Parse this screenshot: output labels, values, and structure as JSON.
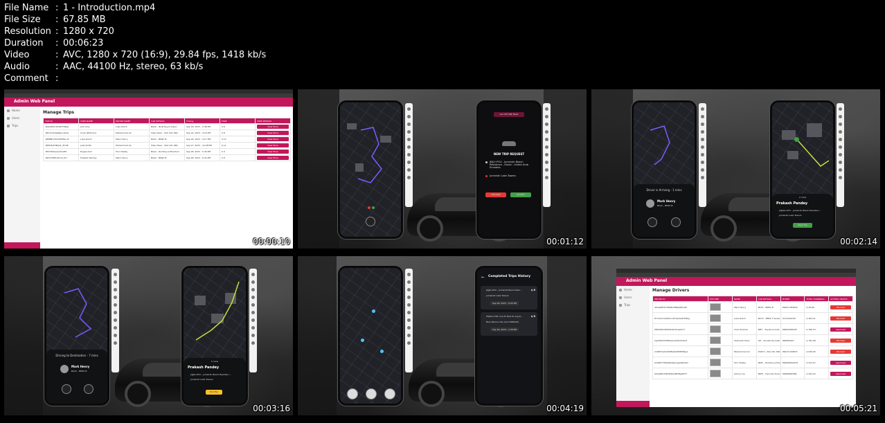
{
  "metadata": [
    {
      "key": "File Name",
      "value": "1 - Introduction.mp4"
    },
    {
      "key": "File Size",
      "value": "67.85 MB"
    },
    {
      "key": "Resolution",
      "value": "1280 x 720"
    },
    {
      "key": "Duration",
      "value": "00:06:23"
    },
    {
      "key": "Video",
      "value": "AVC, 1280 x 720 (16:9), 29.84 fps, 1418 kb/s"
    },
    {
      "key": "Audio",
      "value": "AAC, 44100 Hz, stereo, 63 kb/s"
    },
    {
      "key": "Comment",
      "value": ""
    }
  ],
  "separator": ":",
  "thumbnails": [
    {
      "timestamp": "00:00:10"
    },
    {
      "timestamp": "00:01:12"
    },
    {
      "timestamp": "00:02:14"
    },
    {
      "timestamp": "00:03:16"
    },
    {
      "timestamp": "00:04:19"
    },
    {
      "timestamp": "00:05:21"
    }
  ],
  "admin": {
    "panel_title": "Admin Web Panel",
    "sidebar": [
      "Home",
      "Users",
      "Trips"
    ],
    "trips": {
      "title": "Manage Trips",
      "headers": [
        "TRIP ID",
        "USER NAME",
        "DRIVER NAME",
        "CAR DETAILS",
        "Timing",
        "FARE",
        "VIEW DETAILS"
      ],
      "view_label": "View More",
      "rows": [
        [
          "-NeG9Mhr3K4QfTTNjlw",
          "John Doe",
          "Luke Dutch",
          "Black - Rolls Royce Dawn",
          "Sep 18, 2023 - 2:48 PM",
          "$ 6",
          ""
        ],
        [
          "-NfC1m0QpjNkpvuKhw",
          "Andy Whitmore",
          "Muhammad Ali",
          "Silky Silver - Kite VXL 660",
          "Sep 24, 2023 - 3:16 PM",
          "$ 8",
          ""
        ],
        [
          "-NfNBEr2hkxI9FPNxu B",
          "Luka Dutch",
          "Mark Henry",
          "Black - BMW i8",
          "Sep 26, 2023 - 4:17 PM",
          "$ 12",
          ""
        ],
        [
          "-NfNV6j7HBqx9_rHc5E",
          "Julia Smith",
          "Muhammad Ali",
          "Silky Silver - Kite VXL 660",
          "Sep 27, 2023 - 12:48 PM",
          "$ 11",
          ""
        ],
        [
          "-NfVY9GkiprJoXIocE6",
          "Rogers Kim",
          "Tom Shelby",
          "Black - Roll Royce Phantom",
          "Sep 28, 2023 - 5:40 PM",
          "$ 9",
          ""
        ],
        [
          "-NfQoTWEkdkmX_6rY",
          "Prakash Pandey",
          "Mark Henry",
          "Black - BMW i8",
          "Sep 28, 2023 - 6:34 PM",
          "$ 8",
          ""
        ]
      ]
    },
    "drivers": {
      "title": "Manage Drivers",
      "headers": [
        "DRIVER ID",
        "PICTURE",
        "NAME",
        "CAR DETAILS",
        "PHONE",
        "TOTAL EARNINGS",
        "ACTION / BLOCK"
      ],
      "rows": [
        [
          "4KvaRRhTc7ZRMmMBpDRSx4R",
          "",
          "Mark Henry",
          "BT23 - BMW i8",
          "09005 983650",
          "$ 28.96",
          "Blocked"
        ],
        [
          "EYmhYmxtAKPrnnt07Jx4Q9T5MkjJ",
          "",
          "Luke Dutch",
          "BX72 - BMW 3 Series",
          "0712349790",
          "$ 360.21",
          "Blocked"
        ],
        [
          "PDtIIQ0tdTeFAKCGDYCaj0UY3",
          "",
          "Vinol Sharma",
          "BM7 - Toyota Corolla",
          "09809568978",
          "$ 786.53",
          "Approved"
        ],
        [
          "hgVWPL39TB09qcobOt4dm022",
          "",
          "Shamoah Khan",
          "GH - Sonata Hyundai",
          "090669421",
          "$ 792.08",
          "Blocked"
        ],
        [
          "m4EWme9vWlM5aZsH08H5RJuL",
          "",
          "Muhammad Ali",
          "KS673 - Kite VXL 660",
          "09015 009874",
          "$ 926.95",
          "Blocked"
        ],
        [
          "OoNRF7TMte0PGKeniqpbQRG2Q",
          "",
          "Tom Shelby",
          "MMC - Roll Royce Phantom",
          "090696560233",
          "$ 223.67",
          "Approved"
        ],
        [
          "QXe4RExSfb59tSDeMHMgQPVT",
          "",
          "Johnny Ive",
          "BKTS - Hyundai Tucson",
          "09086680484",
          "$ 444.25",
          "Approved"
        ]
      ]
    }
  },
  "phones": {
    "trip_request": {
      "title": "NEW TRIP REQUEST",
      "pickup": "JKJJ4+PCX - Jumeirah Beach Residence - Dubai - United Arab Emirates",
      "dropoff": "Jumeirah Lake Towers",
      "decline": "DECLINE",
      "accept": "ACCEPT",
      "status": "GO OFFLINE NOW"
    },
    "arriving": {
      "status": "Driver is Arriving - 1 mins",
      "driver_name": "Mark Henry",
      "car": "Black - BMW i8"
    },
    "user_sheet": {
      "distance": "2 mins",
      "name": "Prakash Pandey",
      "pickup": "J4J2J4+PCX - Jumeirah Beach Residenc...",
      "dropoff": "Jumeirah Lake Towers",
      "action": "Start Trip"
    },
    "to_destination": {
      "status": "Driving to Destination - 7 mins",
      "driver_name": "Mark Henry",
      "car": "Black - BMW i8"
    },
    "end_trip": {
      "distance": "5 mins",
      "name": "Prakash Pandey",
      "pickup": "J4JJ4+PCX - Jumeirah Beach Residenc...",
      "dropoff": "Jumeirah Lake Towers",
      "action": "End Trip"
    },
    "history": {
      "title": "Completed Trips History",
      "trips": [
        {
          "from": "JKJJ4+PCX - Jumeirah Beach Resi...",
          "to": "Jumeirah Lake Towers",
          "date": "Sep 28, 2023 - 6:34 PM",
          "fare": "$ 8"
        },
        {
          "from": "H5JH4+FTR, P-Q-TF Bmk B, Al Jad...",
          "to": "Blue Marine City (CLA DIRHAM)",
          "date": "Sep 16, 2023 - 1:38 PM",
          "fare": "$ 8"
        }
      ]
    }
  },
  "colors": {
    "brand": "#c2185b",
    "route": "#7c5cff",
    "route_alt": "#c6e03a",
    "pin": "#4fc3f7"
  }
}
